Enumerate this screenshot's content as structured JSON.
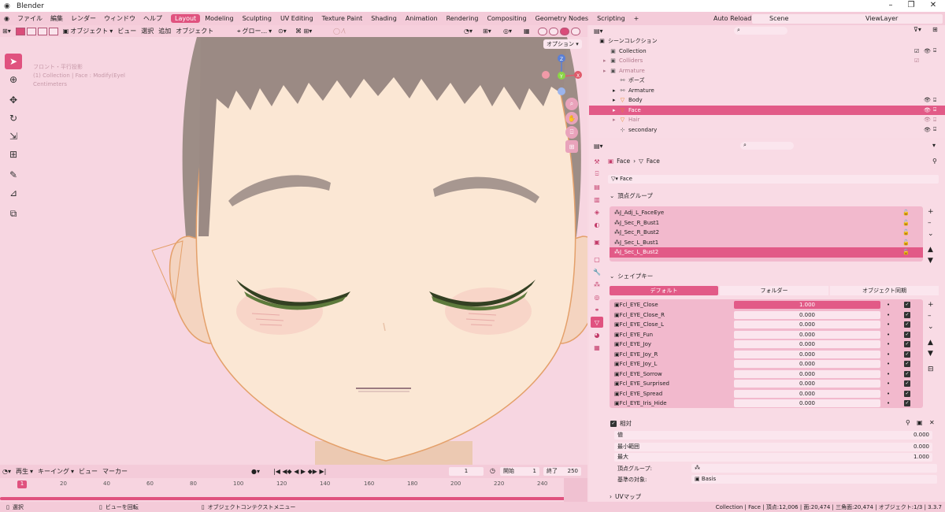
{
  "window": {
    "title": "Blender"
  },
  "menus": [
    "ファイル",
    "編集",
    "レンダー",
    "ウィンドウ",
    "ヘルプ"
  ],
  "workspaces": [
    {
      "label": "Layout",
      "active": true
    },
    {
      "label": "Modeling"
    },
    {
      "label": "Sculpting"
    },
    {
      "label": "UV Editing"
    },
    {
      "label": "Texture Paint"
    },
    {
      "label": "Shading"
    },
    {
      "label": "Animation"
    },
    {
      "label": "Rendering"
    },
    {
      "label": "Compositing"
    },
    {
      "label": "Geometry Nodes"
    },
    {
      "label": "Scripting"
    },
    {
      "label": "+"
    }
  ],
  "topright": {
    "autoreload": "Auto Reload",
    "scene": "Scene",
    "viewlayer": "ViewLayer"
  },
  "viewport_header": {
    "mode": "オブジェクト",
    "view": "ビュー",
    "select": "選択",
    "add": "追加",
    "object": "オブジェクト",
    "transform": "グロー..."
  },
  "viewport": {
    "options": "オプション",
    "info_line1": "フロント・平行投影",
    "info_line2": "(1) Collection | Face : Modify(Eyel",
    "info_line3": "Centimeters",
    "accent": "#e0527f",
    "nav_axes": [
      "X",
      "Y",
      "Z"
    ]
  },
  "outliner": {
    "search_placeholder": "",
    "header": "シーンコレクション",
    "rows": [
      {
        "label": "Collection",
        "indent": 1,
        "icon": "collection-icon",
        "dim": false
      },
      {
        "label": "Colliders",
        "indent": 1,
        "icon": "collection-icon",
        "dim": true
      },
      {
        "label": "Armature",
        "indent": 1,
        "icon": "collection-icon",
        "dim": true
      },
      {
        "label": "ポーズ",
        "indent": 2,
        "icon": "pose-icon",
        "dim": false
      },
      {
        "label": "Armature",
        "indent": 2,
        "icon": "armature-icon",
        "dim": false
      },
      {
        "label": "Body",
        "indent": 2,
        "icon": "mesh-icon",
        "dim": false
      },
      {
        "label": "Face",
        "indent": 2,
        "icon": "mesh-icon",
        "dim": false,
        "selected": true
      },
      {
        "label": "Hair",
        "indent": 2,
        "icon": "mesh-icon",
        "dim": true
      },
      {
        "label": "secondary",
        "indent": 2,
        "icon": "empty-icon",
        "dim": false
      }
    ]
  },
  "properties": {
    "breadcrumb": [
      "Face",
      "Face"
    ],
    "datablock": "Face",
    "vertex_groups_header": "頂点グループ",
    "vertex_groups": [
      "J_Adj_L_FaceEye",
      "J_Sec_R_Bust1",
      "J_Sec_R_Bust2",
      "J_Sec_L_Bust1",
      "J_Sec_L_Bust2"
    ],
    "selected_vg": 4,
    "shape_keys_header": "シェイプキー",
    "shape_tabs": [
      "デフォルト",
      "フォルダー",
      "オブジェクト同期"
    ],
    "shape_keys": [
      {
        "name": "Fcl_EYE_Close",
        "value": "1.000"
      },
      {
        "name": "Fcl_EYE_Close_R",
        "value": "0.000"
      },
      {
        "name": "Fcl_EYE_Close_L",
        "value": "0.000"
      },
      {
        "name": "Fcl_EYE_Fun",
        "value": "0.000"
      },
      {
        "name": "Fcl_EYE_Joy",
        "value": "0.000"
      },
      {
        "name": "Fcl_EYE_Joy_R",
        "value": "0.000"
      },
      {
        "name": "Fcl_EYE_Joy_L",
        "value": "0.000"
      },
      {
        "name": "Fcl_EYE_Sorrow",
        "value": "0.000"
      },
      {
        "name": "Fcl_EYE_Surprised",
        "value": "0.000"
      },
      {
        "name": "Fcl_EYE_Spread",
        "value": "0.000"
      },
      {
        "name": "Fcl_EYE_Iris_Hide",
        "value": "0.000"
      }
    ],
    "relative_label": "相対",
    "value_label": "値",
    "value": "0.000",
    "min_label": "最小範囲",
    "min": "0.000",
    "max_label": "最大",
    "max": "1.000",
    "vgroup_label": "頂点グループ:",
    "vgroup": "",
    "basis_label": "基準の対象:",
    "basis": "Basis",
    "uvmap_header": "UVマップ"
  },
  "timeline": {
    "play": "再生",
    "keying": "キーイング",
    "view": "ビュー",
    "marker": "マーカー",
    "current": "1",
    "start_label": "開始",
    "start": "1",
    "end_label": "終了",
    "end": "250",
    "ticks": [
      "1",
      "20",
      "40",
      "60",
      "80",
      "100",
      "120",
      "140",
      "160",
      "180",
      "200",
      "220",
      "240"
    ]
  },
  "status": {
    "select": "選択",
    "rotate": "ビューを回転",
    "context": "オブジェクトコンテクストメニュー",
    "stats": "Collection | Face | 頂点:12,006 | 面:20,474 | 三角面:20,474 | オブジェクト:1/3 | 3.3.7"
  }
}
